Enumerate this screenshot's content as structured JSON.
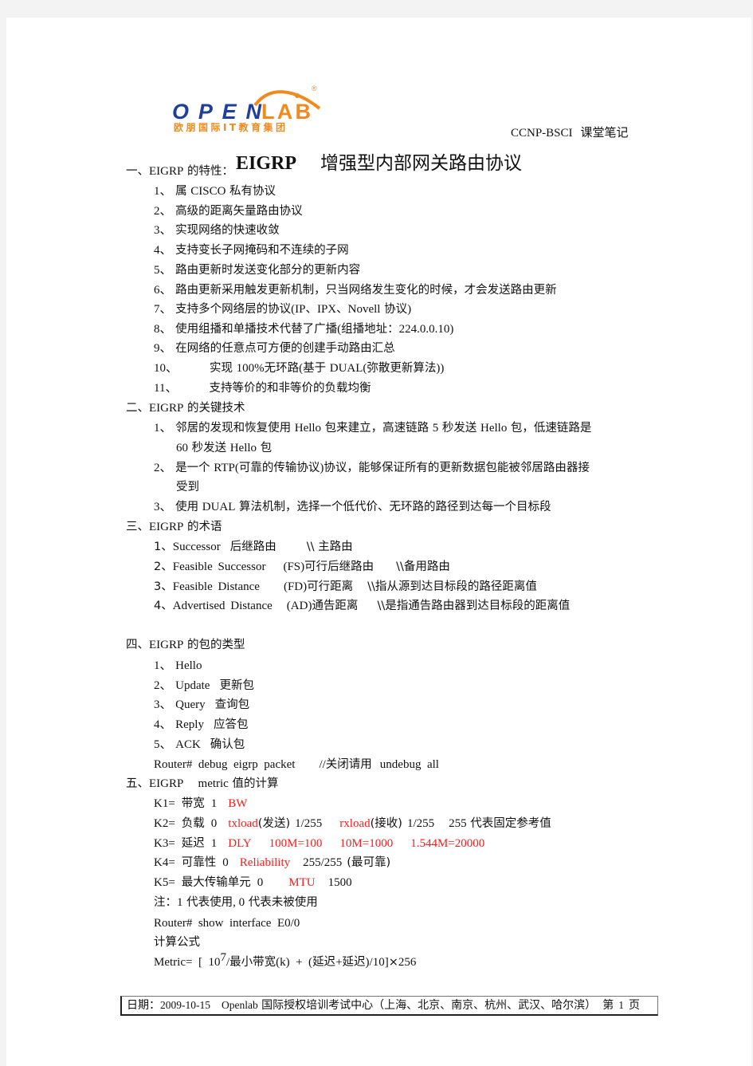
{
  "header": {
    "logo": {
      "brand_part1": "OPEN",
      "brand_part2": "LAB",
      "registered": "®",
      "subtitle": "欧朋国际IT教育集团",
      "colors": {
        "blue": "#1f3f99",
        "orange": "#f08a1c"
      }
    },
    "course": "CCNP-BSCI",
    "notes_label": "课堂笔记"
  },
  "title": {
    "en": "EIGRP",
    "cn": "增强型内部网关路由协议"
  },
  "sections": {
    "s1": {
      "heading_prefix": "一、",
      "heading_en": "EIGRP",
      "heading_cn": " 的特性：",
      "items": [
        {
          "num": "1、",
          "parts": [
            "属 ",
            "CISCO",
            " 私有协议"
          ]
        },
        {
          "num": "2、",
          "text": "高级的距离矢量路由协议"
        },
        {
          "num": "3、",
          "text": "实现网络的快速收敛"
        },
        {
          "num": "4、",
          "text": "支持变长子网掩码和不连续的子网"
        },
        {
          "num": "5、",
          "text": "路由更新时发送变化部分的更新内容"
        },
        {
          "num": "6、",
          "text": "路由更新采用触发更新机制，只当网络发生变化的时候，才会发送路由更新"
        },
        {
          "num": "7、",
          "parts": [
            "支持多个网络层的协议",
            "(IP",
            "、",
            "IPX",
            "、",
            "Novell",
            " 协议",
            ")"
          ]
        },
        {
          "num": "8、",
          "parts": [
            "使用组播和单播技术代替了广播",
            "(",
            "组播地址：",
            "224.0.0.10)"
          ]
        },
        {
          "num": "9、",
          "text": "在网络的任意点可方便的创建手动路由汇总"
        },
        {
          "num": "10、",
          "parts": [
            "实现 ",
            "100%",
            "无环路",
            "(",
            "基于 ",
            "DUAL(",
            "弥散更新算法",
            "))"
          ]
        },
        {
          "num": "11、",
          "text": "支持等价的和非等价的负载均衡"
        }
      ]
    },
    "s2": {
      "heading_prefix": "二、",
      "heading_en": "EIGRP",
      "heading_cn": " 的关键技术",
      "items": [
        {
          "num": "1、",
          "line1": [
            "邻居的发现和恢复使用 ",
            "Hello",
            " 包来建立，高速链路 ",
            "5",
            " 秒发送 ",
            "Hello",
            " 包，低速链路是"
          ],
          "line2": [
            "60",
            " 秒发送 ",
            "Hello",
            " 包"
          ]
        },
        {
          "num": "2、",
          "line1": [
            "是一个 ",
            "RTP(",
            "可靠的传输协议",
            ")",
            "协议，能够保证所有的更新数据包能被邻居路由器接"
          ],
          "line2": [
            "受到"
          ]
        },
        {
          "num": "3、",
          "parts": [
            "使用 ",
            "DUAL",
            " 算法机制，选择一个低代价、无环路的路径到达每一个目标段"
          ]
        }
      ]
    },
    "s3": {
      "heading_prefix": "三、",
      "heading_en": "EIGRP",
      "heading_cn": " 的术语",
      "items": [
        {
          "num": "1、",
          "term": "Successor",
          "abbr": "",
          "cn": "后继路由",
          "note": "\\\\  主路由"
        },
        {
          "num": "2、",
          "term": "Feasible  Successor",
          "abbr": "(FS)",
          "cn": "可行后继路由",
          "note": "\\\\备用路由"
        },
        {
          "num": "3、",
          "term": "Feasible  Distance",
          "abbr": "(FD)",
          "cn": "可行距离",
          "note": "\\\\指从源到达目标段的路径距离值"
        },
        {
          "num": "4、",
          "term": "Advertised  Distance",
          "abbr": "(AD)",
          "cn": "通告距离",
          "note": "\\\\是指通告路由器到达目标段的距离值"
        }
      ]
    },
    "s4": {
      "heading_prefix": "四、",
      "heading_en": "EIGRP",
      "heading_cn": " 的包的类型",
      "items": [
        {
          "num": "1、",
          "en": "Hello",
          "cn": ""
        },
        {
          "num": "2、",
          "en": "Update",
          "cn": "更新包"
        },
        {
          "num": "3、",
          "en": "Query",
          "cn": "查询包"
        },
        {
          "num": "4、",
          "en": "Reply",
          "cn": "应答包"
        },
        {
          "num": "5、",
          "en": "ACK",
          "cn": "确认包"
        }
      ],
      "command": {
        "cmd": "Router#  debug  eigrp  packet",
        "comment_prefix": "//",
        "comment_cn": "关闭请用",
        "comment_cmd": "undebug  all"
      }
    },
    "s5": {
      "heading_prefix": "五、",
      "heading_en": "EIGRP     metric",
      "heading_cn": " 值的计算",
      "k1": {
        "label": "K1=",
        "cn": "带宽",
        "val": "1",
        "red": "BW"
      },
      "k2": {
        "label": "K2=",
        "cn": "负载",
        "val": "0",
        "red1": "txload",
        "cn1": "(发送)",
        "v1": "1/255",
        "red2": "rxload",
        "cn2": "(接收)",
        "v2": "1/255",
        "tail_num": "255",
        "tail_cn": " 代表固定参考值"
      },
      "k3": {
        "label": "K3=",
        "cn": "延迟",
        "val": "1",
        "red": [
          "DLY",
          "100M=100",
          "10M=1000",
          "1.544M=20000"
        ]
      },
      "k4": {
        "label": "K4=",
        "cn": "可靠性",
        "val": "0",
        "red": "Reliability",
        "tail": "255/255",
        "tail_cn": "(最可靠)"
      },
      "k5": {
        "label": "K5=",
        "cn": "最大传输单元",
        "val": "0",
        "red": "MTU",
        "tail": "1500"
      },
      "note": {
        "cn1": "注：",
        "n1": "1",
        "cn2": " 代表使用",
        "sep": ", ",
        "n2": "0",
        "cn3": " 代表未被使用"
      },
      "command": "Router#  show  interface  E0/0",
      "formula_label": "计算公式",
      "formula": {
        "p1": "Metric=  [  10",
        "exp": "7",
        "p2": "/",
        "cn1": "最小带宽",
        "p3": "(k)  +  (",
        "cn2": "延迟",
        "p4": "+",
        "cn3": "延迟",
        "p5": ")/10]",
        "p6": "×",
        "p7": "256"
      }
    }
  },
  "footer": {
    "date_label": "日期：",
    "date": "2009-10-15",
    "org_en": "Openlab",
    "org_cn": " 国际授权培训考试中心（上海、北京、南京、杭州、武汉、哈尔滨）",
    "page_prefix": "第",
    "page_num": "1",
    "page_suffix": "页"
  },
  "colors": {
    "highlight_red": "#ff1a1a",
    "text": "#111111",
    "background": "#f3f3f3"
  }
}
